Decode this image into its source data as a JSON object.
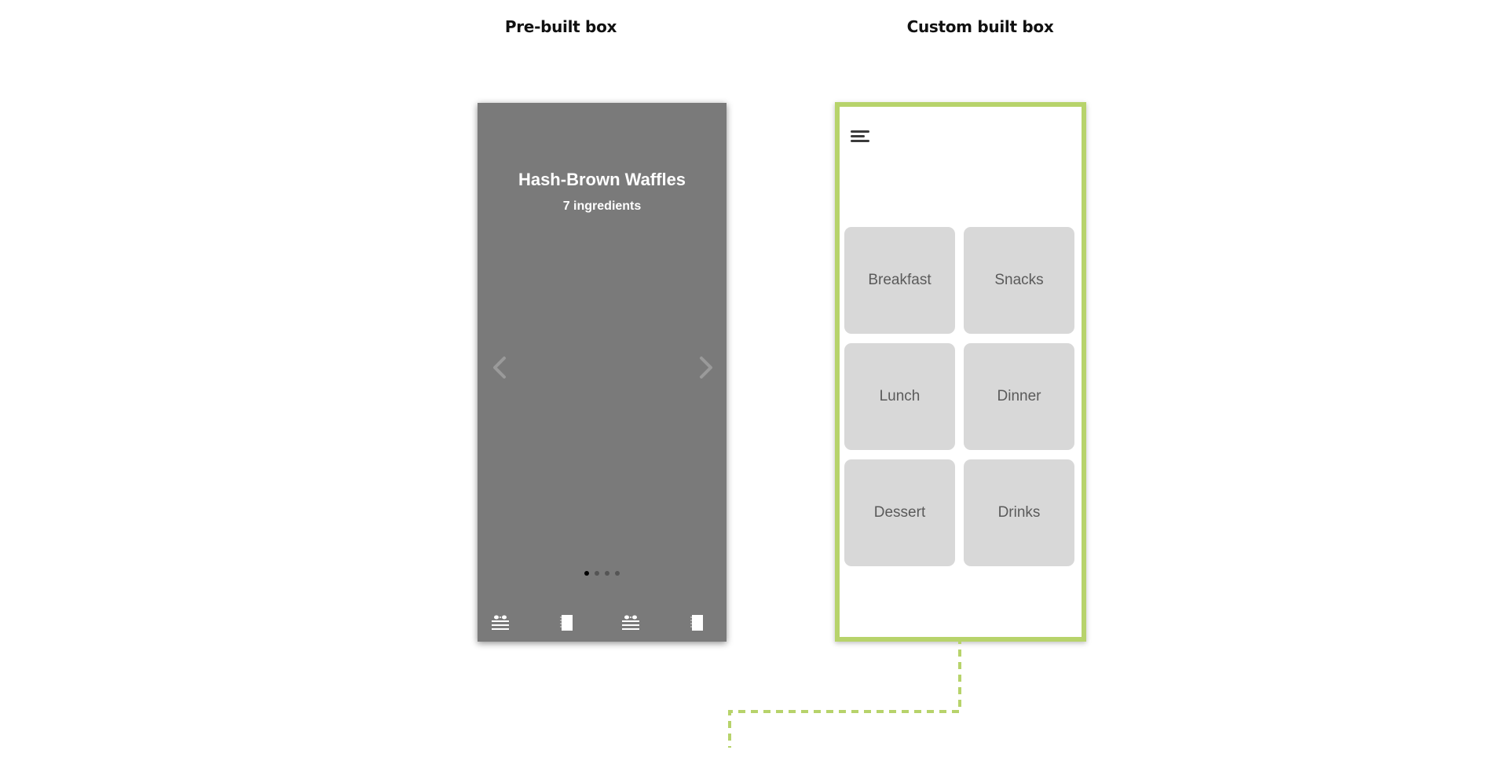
{
  "headers": {
    "prebuilt": "Pre-built box",
    "custom": "Custom built box"
  },
  "prebuilt_box": {
    "recipe_title": "Hash-Brown Waffles",
    "recipe_subtitle": "7 ingredients",
    "carousel": {
      "page_count": 4,
      "active_index": 0
    },
    "nav": {
      "prev_icon": "chevron-left",
      "next_icon": "chevron-right"
    },
    "tab_icons": [
      "food-basket-icon",
      "notebook-icon",
      "food-basket-icon",
      "notebook-icon"
    ],
    "background_color": "#7a7a7a"
  },
  "custom_box": {
    "menu_icon": "hamburger-menu",
    "categories": [
      "Breakfast",
      "Snacks",
      "Lunch",
      "Dinner",
      "Dessert",
      "Drinks"
    ],
    "border_color": "#b7d36b",
    "tile_color": "#d8d8d8"
  },
  "connector": {
    "style": "dashed",
    "color": "#b7d36b"
  }
}
